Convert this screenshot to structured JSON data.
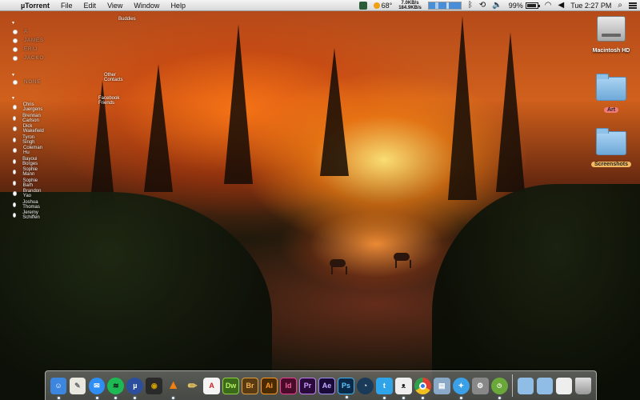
{
  "menubar": {
    "app_name": "µTorrent",
    "menus": [
      "File",
      "Edit",
      "View",
      "Window",
      "Help"
    ],
    "temperature": "68°",
    "upload_rate": "7.0KB/s",
    "download_rate": "184.9KB/s",
    "battery_percent": "99%",
    "clock": "Tue 2:27 PM"
  },
  "buddy_list": {
    "groups": [
      {
        "title": "Buddies"
      },
      {
        "title": "Other Contacts"
      },
      {
        "title": "Facebook Friends"
      }
    ],
    "faded_entries": [
      "A",
      "JAMES",
      "ERIJ",
      "JACKO",
      "N",
      "NONE"
    ],
    "contacts": [
      "Chris Juergens",
      "Brennan Carlson",
      "Dick Wakefield",
      "Tyron Singh",
      "Coleman Hu",
      "Bayoui Borges",
      "Sophie Mann",
      "Sophie Barh",
      "Brandon Yao",
      "Joshua Thomas",
      "Jeremy Schiffen"
    ]
  },
  "desktop": {
    "items": [
      {
        "label": "Macintosh HD",
        "icon": "hard-drive-icon"
      },
      {
        "label": "Art",
        "icon": "folder-icon",
        "tag_color": "#f07a7a"
      },
      {
        "label": "Screenshots",
        "icon": "folder-icon",
        "tag_color": "#f4b860"
      }
    ]
  },
  "dock": {
    "apps": [
      {
        "name": "finder",
        "glyph": "☺",
        "color": "#3d86e0"
      },
      {
        "name": "textedit",
        "glyph": "✎",
        "color": "#e8e8e0"
      },
      {
        "name": "messages",
        "glyph": "💬",
        "color": "#2f8ef4"
      },
      {
        "name": "spotify",
        "glyph": "≋",
        "color": "#1db954"
      },
      {
        "name": "utorrent",
        "glyph": "µ",
        "color": "#2b4f9e"
      },
      {
        "name": "speakers",
        "glyph": "◉",
        "color": "#2a2a2a"
      },
      {
        "name": "vlc",
        "glyph": "▲",
        "color": "#f08010"
      },
      {
        "name": "pencil",
        "glyph": "✏",
        "color": "#c9a040"
      },
      {
        "name": "acrobat",
        "glyph": "A",
        "color": "#d02020"
      },
      {
        "name": "dreamweaver",
        "glyph": "Dw",
        "color": "#3a6a1a"
      },
      {
        "name": "bridge",
        "glyph": "Br",
        "color": "#5a3a10"
      },
      {
        "name": "illustrator",
        "glyph": "Ai",
        "color": "#4a2a00"
      },
      {
        "name": "indesign",
        "glyph": "Id",
        "color": "#4a0a2a"
      },
      {
        "name": "premiere",
        "glyph": "Pr",
        "color": "#2a0a3a"
      },
      {
        "name": "after-effects",
        "glyph": "Ae",
        "color": "#1a0a3a"
      },
      {
        "name": "photoshop",
        "glyph": "Ps",
        "color": "#0a2a4a"
      },
      {
        "name": "steam",
        "glyph": "◔",
        "color": "#1a3a5a"
      },
      {
        "name": "twitter",
        "glyph": "🐦",
        "color": "#2fa4e8"
      },
      {
        "name": "growl",
        "glyph": "ᴥ",
        "color": "#eeeeee"
      },
      {
        "name": "chrome",
        "glyph": "◎",
        "color": "#e04030"
      },
      {
        "name": "preview",
        "glyph": "▤",
        "color": "#8aa8c8"
      },
      {
        "name": "safari",
        "glyph": "✦",
        "color": "#3aa0e8"
      },
      {
        "name": "system-preferences",
        "glyph": "⚙",
        "color": "#888888"
      },
      {
        "name": "gpu-monitor",
        "glyph": "◷",
        "color": "#6aa83a"
      }
    ],
    "stacks": [
      {
        "name": "applications-folder",
        "color": "#8fbde6"
      },
      {
        "name": "documents-folder",
        "color": "#8fbde6"
      },
      {
        "name": "downloads-stack",
        "color": "#eeeeee"
      },
      {
        "name": "trash",
        "color": "#bbbbbb"
      }
    ]
  }
}
